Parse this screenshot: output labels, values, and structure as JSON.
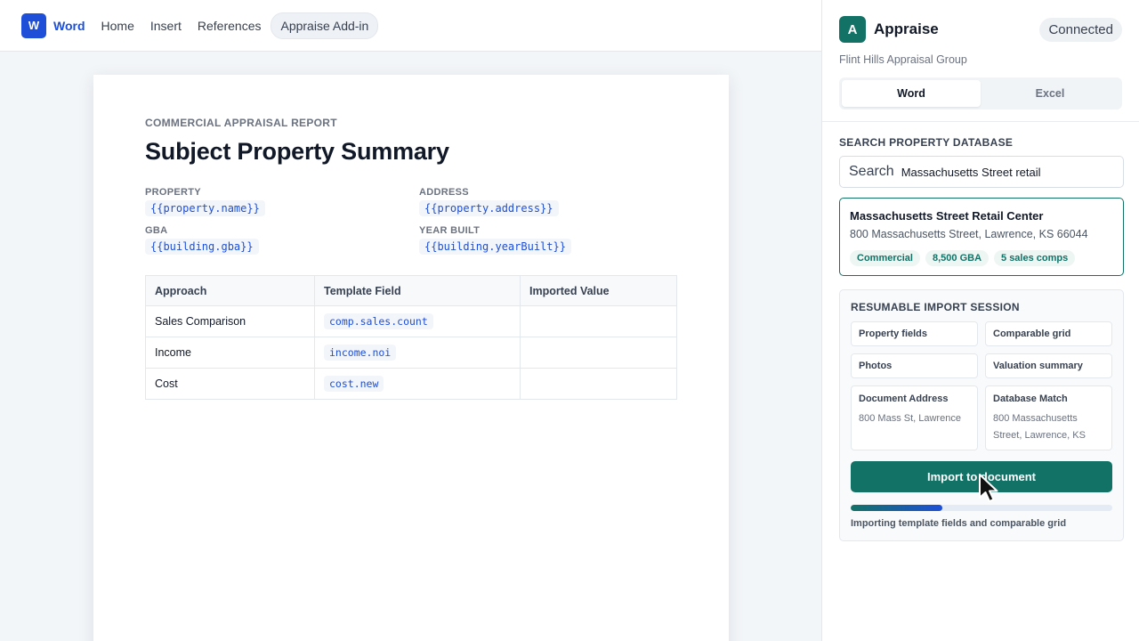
{
  "topbar": {
    "logo_letter": "W",
    "brand": "Word",
    "nav": [
      {
        "label": "Home"
      },
      {
        "label": "Insert"
      },
      {
        "label": "References"
      },
      {
        "label": "Appraise Add-in"
      }
    ]
  },
  "document": {
    "eyebrow": "COMMERCIAL APPRAISAL REPORT",
    "title": "Subject Property Summary",
    "fields": [
      {
        "label": "PROPERTY",
        "token": "{{property.name}}"
      },
      {
        "label": "ADDRESS",
        "token": "{{property.address}}"
      },
      {
        "label": "GBA",
        "token": "{{building.gba}}"
      },
      {
        "label": "YEAR BUILT",
        "token": "{{building.yearBuilt}}"
      }
    ],
    "table": {
      "headers": [
        "Approach",
        "Template Field",
        "Imported Value"
      ],
      "rows": [
        {
          "approach": "Sales Comparison",
          "field": "comp.sales.count",
          "value": ""
        },
        {
          "approach": "Income",
          "field": "income.noi",
          "value": ""
        },
        {
          "approach": "Cost",
          "field": "cost.new",
          "value": ""
        }
      ]
    }
  },
  "panel": {
    "app_letter": "A",
    "app_name": "Appraise",
    "status": "Connected",
    "org": "Flint Hills Appraisal Group",
    "tabs": [
      {
        "label": "Word"
      },
      {
        "label": "Excel"
      }
    ],
    "search": {
      "label": "SEARCH PROPERTY DATABASE",
      "prefix": "Search",
      "value": "Massachusetts Street retail"
    },
    "result": {
      "title": "Massachusetts Street Retail Center",
      "address": "800 Massachusetts Street, Lawrence, KS 66044",
      "tags": [
        "Commercial",
        "8,500 GBA",
        "5 sales comps"
      ]
    },
    "session": {
      "title": "RESUMABLE IMPORT SESSION",
      "items": [
        "Property fields",
        "Comparable grid",
        "Photos",
        "Valuation summary"
      ],
      "doc_address": {
        "label": "Document Address",
        "value": "800 Mass St, Lawrence"
      },
      "db_match": {
        "label": "Database Match",
        "value": "800 Massachusetts Street, Lawrence, KS"
      },
      "button": "Import to document",
      "progress_fraction": 0.35,
      "progress_text": "Importing template fields and comparable grid"
    }
  },
  "colors": {
    "word_blue": "#1d4fd8",
    "brand_green": "#137266"
  }
}
